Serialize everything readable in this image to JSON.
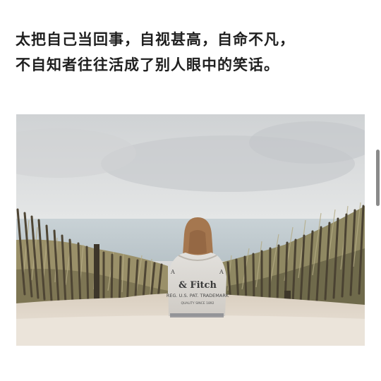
{
  "article": {
    "lines": [
      "太把自己当回事，自视甚高，自命不凡，",
      "不自知者往往活成了别人眼中的笑话。"
    ]
  },
  "photo": {
    "hoodie_text": {
      "line1": "& Fitch",
      "line2": "REG. U.S. PAT. TRADEMARK",
      "line3": "QUALITY SINCE 1892"
    }
  },
  "colors": {
    "sky": "#d6d8da",
    "sea": "#c3ccd0",
    "sand": "#e2d8cb",
    "grass": "#a39a72",
    "text": "#1f1f1f"
  }
}
